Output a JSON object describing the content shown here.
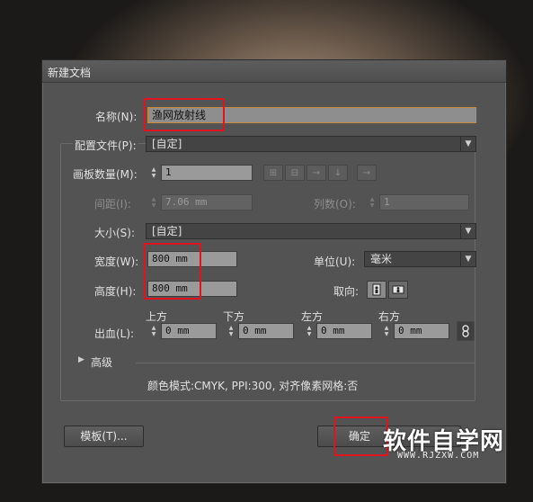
{
  "dialog": {
    "title": "新建文档",
    "name_label": "名称(N):",
    "name_value": "渔网放射线",
    "profile_label": "配置文件(P):",
    "profile_value": "[自定]",
    "artboards_label": "画板数量(M):",
    "artboards_value": "1",
    "spacing_label": "间距(I):",
    "spacing_value": "7.06 mm",
    "columns_label": "列数(O):",
    "columns_value": "1",
    "size_label": "大小(S):",
    "size_value": "[自定]",
    "width_label": "宽度(W):",
    "width_value": "800 mm",
    "units_label": "单位(U):",
    "units_value": "毫米",
    "height_label": "高度(H):",
    "height_value": "800 mm",
    "orientation_label": "取向:",
    "bleed_label": "出血(L):",
    "bleed": {
      "top_label": "上方",
      "top_value": "0 mm",
      "bottom_label": "下方",
      "bottom_value": "0 mm",
      "left_label": "左方",
      "left_value": "0 mm",
      "right_label": "右方",
      "right_value": "0 mm"
    },
    "advanced_label": "高级",
    "info_text": "颜色模式:CMYK, PPI:300, 对齐像素网格:否",
    "template_button": "模板(T)...",
    "ok_button": "确定"
  },
  "watermark": {
    "text": "软件自学网",
    "sub": "WWW.RJZXW.COM"
  },
  "colors": {
    "highlight": "#e0141e",
    "field_focus": "#c88a3a"
  }
}
